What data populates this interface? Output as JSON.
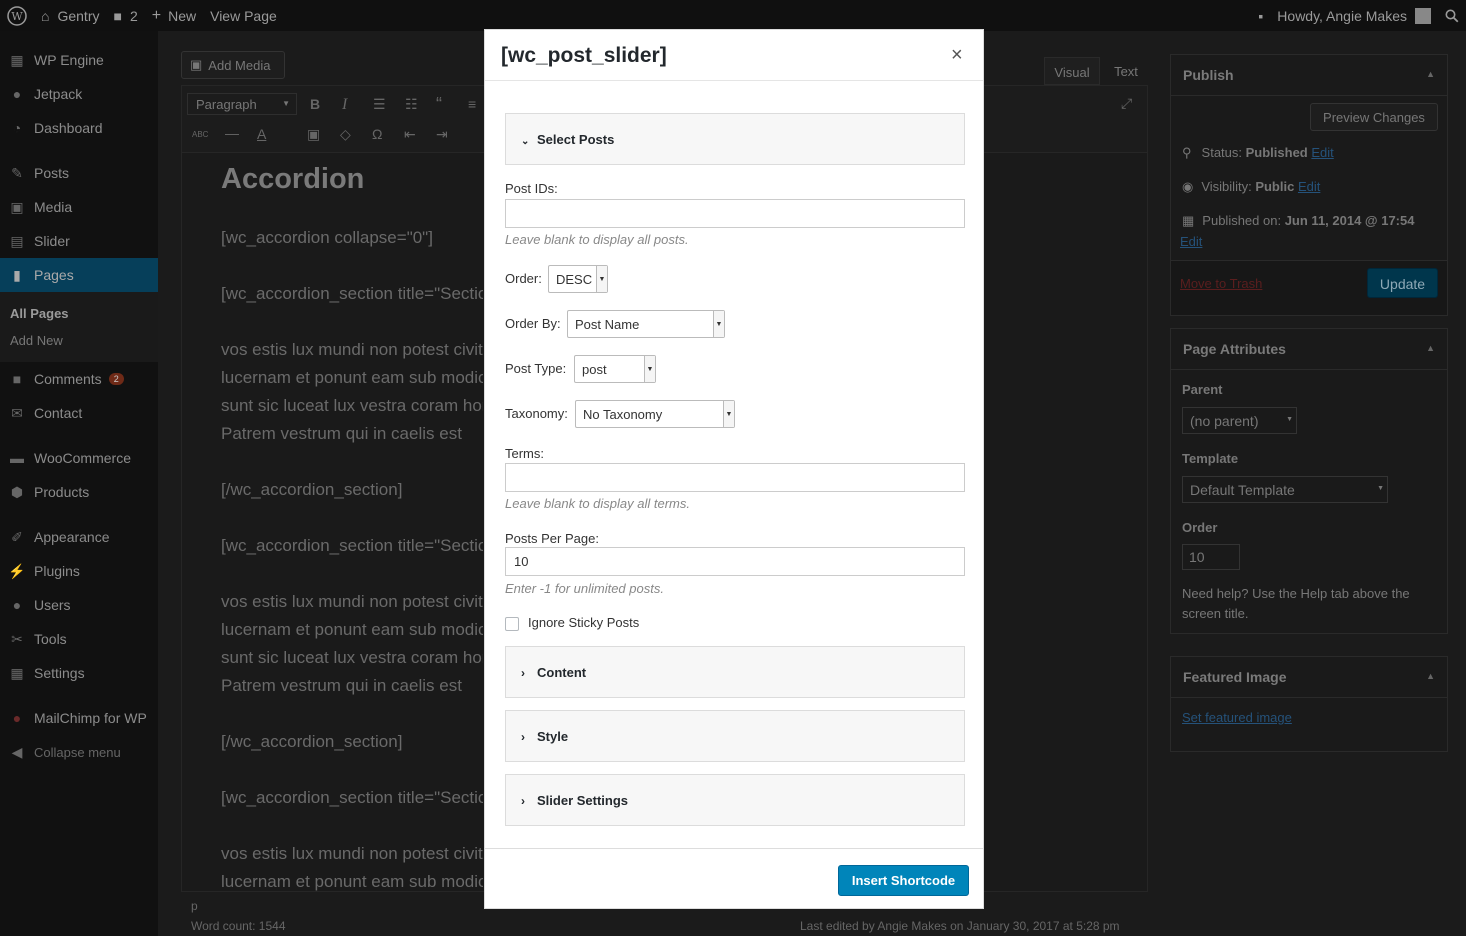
{
  "admin_bar": {
    "site_name": "Gentry",
    "comments_count": "2",
    "new_label": "New",
    "view_page_label": "View Page",
    "howdy": "Howdy, Angie Makes"
  },
  "sidebar": {
    "items": [
      {
        "label": "WP Engine"
      },
      {
        "label": "Jetpack"
      },
      {
        "label": "Dashboard"
      },
      {
        "label": "Posts"
      },
      {
        "label": "Media"
      },
      {
        "label": "Slider"
      },
      {
        "label": "Pages"
      },
      {
        "label": "Comments",
        "badge": "2"
      },
      {
        "label": "Contact"
      },
      {
        "label": "WooCommerce"
      },
      {
        "label": "Products"
      },
      {
        "label": "Appearance"
      },
      {
        "label": "Plugins"
      },
      {
        "label": "Users"
      },
      {
        "label": "Tools"
      },
      {
        "label": "Settings"
      },
      {
        "label": "MailChimp for WP"
      },
      {
        "label": "Collapse menu"
      }
    ],
    "submenu": {
      "all_pages": "All Pages",
      "add_new": "Add New"
    }
  },
  "editor": {
    "add_media": "Add Media",
    "tab_visual": "Visual",
    "tab_text": "Text",
    "format_select": "Paragraph",
    "title": "Accordion",
    "lines": [
      "[wc_accordion collapse=\"0\"]",
      "[wc_accordion_section title=\"Section",
      "vos estis lux mundi non potest civitas",
      "lucernam et ponunt eam sub modio",
      "sunt sic luceat lux vestra coram hom",
      "Patrem vestrum qui in caelis est",
      "[/wc_accordion_section]",
      "[wc_accordion_section title=\"Section",
      "vos estis lux mundi non potest civitas",
      "lucernam et ponunt eam sub modio",
      "sunt sic luceat lux vestra coram hom",
      "Patrem vestrum qui in caelis est",
      "[/wc_accordion_section]",
      "[wc_accordion_section title=\"Section",
      "vos estis lux mundi non potest civitas",
      "lucernam et ponunt eam sub modio"
    ],
    "path": "p",
    "word_count": "Word count: 1544",
    "last_edited": "Last edited by Angie Makes on January 30, 2017 at 5:28 pm"
  },
  "publish": {
    "title": "Publish",
    "preview": "Preview Changes",
    "status_label": "Status:",
    "status_value": "Published",
    "visibility_label": "Visibility:",
    "visibility_value": "Public",
    "published_label": "Published on:",
    "published_value": "Jun 11, 2014 @ 17:54",
    "edit": "Edit",
    "trash": "Move to Trash",
    "update": "Update"
  },
  "page_attributes": {
    "title": "Page Attributes",
    "parent_label": "Parent",
    "parent_value": "(no parent)",
    "template_label": "Template",
    "template_value": "Default Template",
    "order_label": "Order",
    "order_value": "10",
    "help_line1": "Need help? Use the Help tab above the",
    "help_line2": "screen title."
  },
  "featured_image": {
    "title": "Featured Image",
    "link": "Set featured image"
  },
  "modal": {
    "title": "[wc_post_slider]",
    "close": "×",
    "select_posts": "Select Posts",
    "post_ids_label": "Post IDs:",
    "post_ids_value": "",
    "post_ids_hint": "Leave blank to display all posts.",
    "order_label": "Order:",
    "order_value": "DESC",
    "order_by_label": "Order By:",
    "order_by_value": "Post Name",
    "post_type_label": "Post Type:",
    "post_type_value": "post",
    "taxonomy_label": "Taxonomy:",
    "taxonomy_value": "No Taxonomy",
    "terms_label": "Terms:",
    "terms_value": "",
    "terms_hint": "Leave blank to display all terms.",
    "ppp_label": "Posts Per Page:",
    "ppp_value": "10",
    "ppp_hint": "Enter -1 for unlimited posts.",
    "ignore_sticky": "Ignore Sticky Posts",
    "content": "Content",
    "style": "Style",
    "slider_settings": "Slider Settings",
    "insert": "Insert Shortcode"
  }
}
